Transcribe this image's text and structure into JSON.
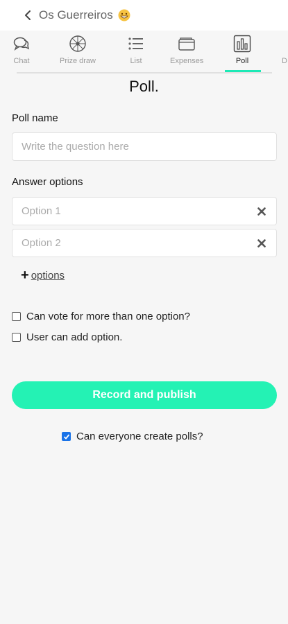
{
  "header": {
    "title": "Os Guerreiros",
    "back_icon": "chevron-left-icon",
    "emoji_icon": "grinning-face-icon"
  },
  "tabs": [
    {
      "label": "Chat",
      "icon": "chat-bubbles-icon"
    },
    {
      "label": "Prize draw",
      "icon": "wheel-icon"
    },
    {
      "label": "List",
      "icon": "list-icon"
    },
    {
      "label": "Expenses",
      "icon": "wallet-icon"
    },
    {
      "label": "Poll",
      "icon": "bar-chart-icon",
      "active": true
    },
    {
      "label": "D",
      "icon": ""
    }
  ],
  "page": {
    "title": "Poll.",
    "poll_name_label": "Poll name",
    "poll_name_placeholder": "Write the question here",
    "answer_options_label": "Answer options",
    "options": [
      {
        "placeholder": "Option 1"
      },
      {
        "placeholder": "Option 2"
      }
    ],
    "add_options_label": "options",
    "multi_vote_label": "Can vote for more than one option?",
    "multi_vote_checked": false,
    "user_add_label": "User can add option.",
    "user_add_checked": false,
    "publish_label": "Record and publish",
    "everyone_create_label": "Can everyone create polls?",
    "everyone_create_checked": true
  },
  "colors": {
    "accent": "#24f2b4",
    "tab_underline": "#1de9b6",
    "checkbox_checked": "#1a73e8",
    "background": "#f6f6f6"
  }
}
